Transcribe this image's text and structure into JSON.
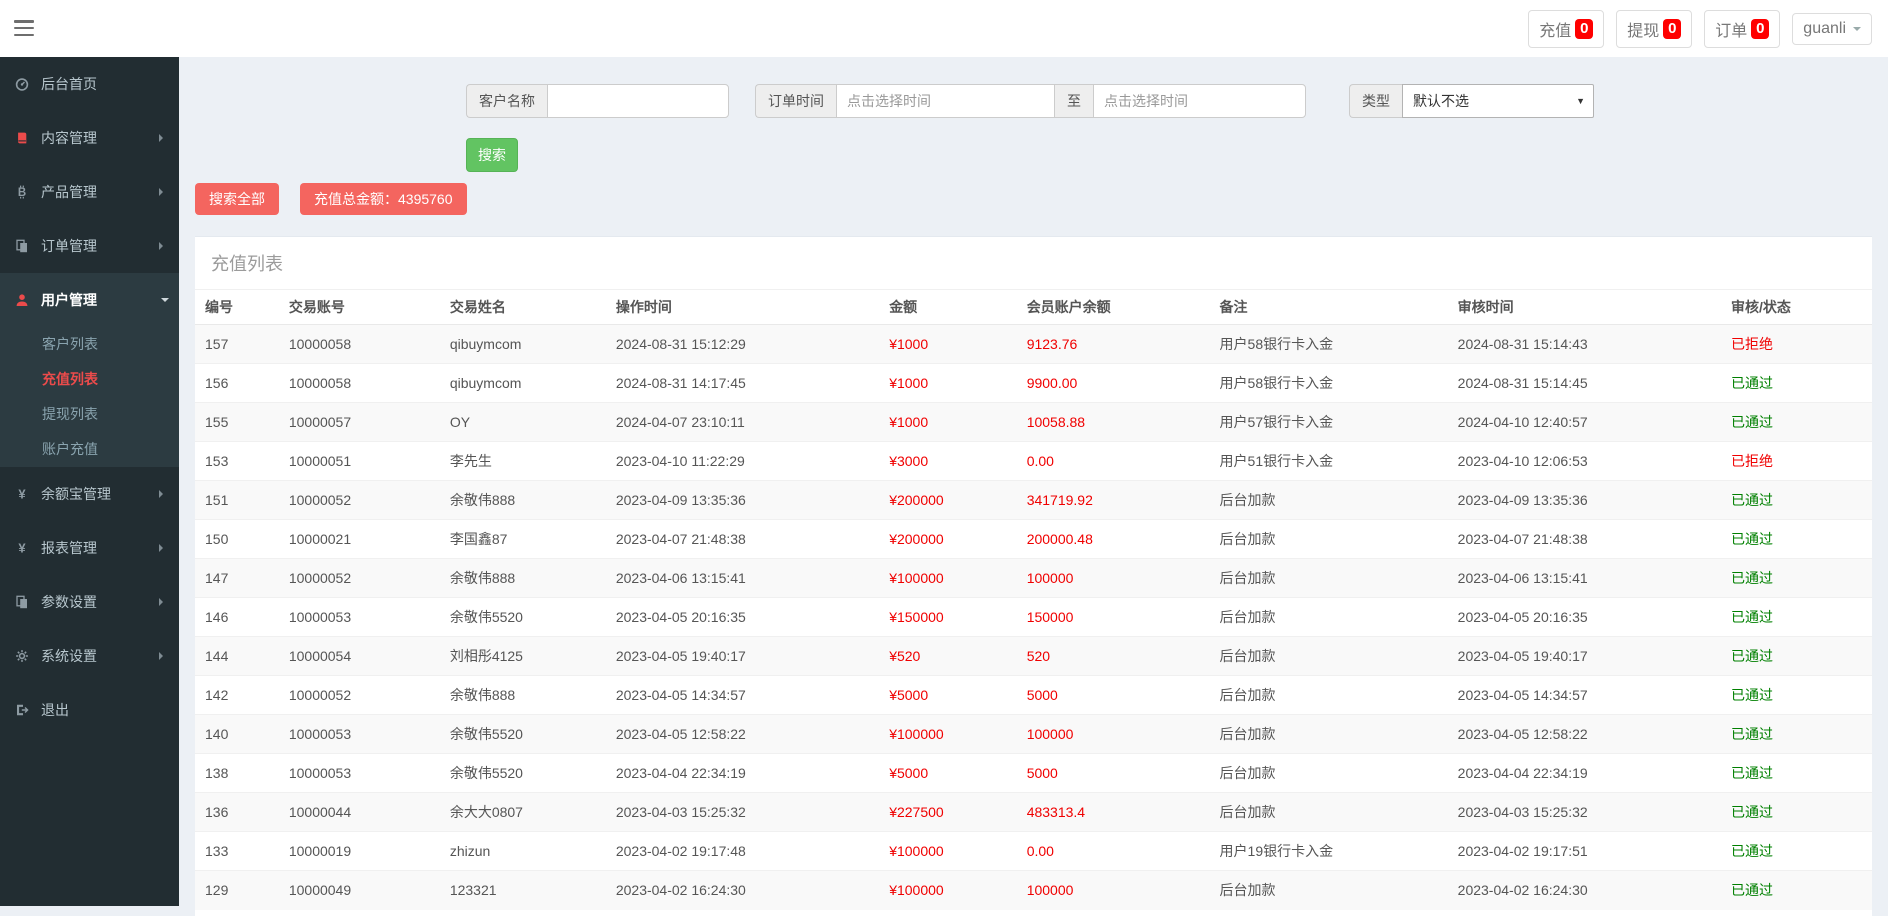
{
  "topbar": {
    "buttons": [
      {
        "label": "充值",
        "count": "0"
      },
      {
        "label": "提现",
        "count": "0"
      },
      {
        "label": "订单",
        "count": "0"
      }
    ],
    "user": {
      "name": "guanli"
    }
  },
  "sidebar": {
    "items": [
      {
        "key": "home",
        "label": "后台首页",
        "icon": "dashboard",
        "has_children": false,
        "icon_red": false
      },
      {
        "key": "content",
        "label": "内容管理",
        "icon": "book",
        "has_children": true,
        "icon_red": true
      },
      {
        "key": "product",
        "label": "产品管理",
        "icon": "bitcoin",
        "has_children": true,
        "icon_red": false
      },
      {
        "key": "order",
        "label": "订单管理",
        "icon": "files",
        "has_children": true,
        "icon_red": false
      },
      {
        "key": "user",
        "label": "用户管理",
        "icon": "user",
        "has_children": true,
        "icon_red": true,
        "active": true,
        "children": [
          {
            "key": "customer-list",
            "label": "客户列表",
            "active": false
          },
          {
            "key": "recharge-list",
            "label": "充值列表",
            "active": true
          },
          {
            "key": "withdraw-list",
            "label": "提现列表",
            "active": false
          },
          {
            "key": "account-recharge",
            "label": "账户充值",
            "active": false
          }
        ]
      },
      {
        "key": "yuebao",
        "label": "余额宝管理",
        "icon": "yen",
        "has_children": true,
        "icon_red": false
      },
      {
        "key": "report",
        "label": "报表管理",
        "icon": "yen",
        "has_children": true,
        "icon_red": false
      },
      {
        "key": "params",
        "label": "参数设置",
        "icon": "files",
        "has_children": true,
        "icon_red": false
      },
      {
        "key": "system",
        "label": "系统设置",
        "icon": "gears",
        "has_children": true,
        "icon_red": false
      },
      {
        "key": "logout",
        "label": "退出",
        "icon": "logout",
        "has_children": false,
        "icon_red": false
      }
    ]
  },
  "filters": {
    "customer_label": "客户名称",
    "customer_value": "",
    "time_label": "订单时间",
    "time_placeholder": "点击选择时间",
    "to_label": "至",
    "type_label": "类型",
    "type_value": "默认不选",
    "search_label": "搜索"
  },
  "summary": {
    "search_all": "搜索全部",
    "total": "充值总金额：4395760"
  },
  "panel": {
    "title": "充值列表"
  },
  "table": {
    "columns": [
      "编号",
      "交易账号",
      "交易姓名",
      "操作时间",
      "金额",
      "会员账户余额",
      "备注",
      "审核时间",
      "审核/状态"
    ],
    "rows": [
      {
        "id": "157",
        "account": "10000058",
        "name": "qibuymcom",
        "time": "2024-08-31 15:12:29",
        "amount": "¥1000",
        "balance": "9123.76",
        "note": "用户58银行卡入金",
        "audit_time": "2024-08-31 15:14:43",
        "status": "已拒绝",
        "state": "rejected"
      },
      {
        "id": "156",
        "account": "10000058",
        "name": "qibuymcom",
        "time": "2024-08-31 14:17:45",
        "amount": "¥1000",
        "balance": "9900.00",
        "note": "用户58银行卡入金",
        "audit_time": "2024-08-31 15:14:45",
        "status": "已通过",
        "state": "approved"
      },
      {
        "id": "155",
        "account": "10000057",
        "name": "OY",
        "time": "2024-04-07 23:10:11",
        "amount": "¥1000",
        "balance": "10058.88",
        "note": "用户57银行卡入金",
        "audit_time": "2024-04-10 12:40:57",
        "status": "已通过",
        "state": "approved"
      },
      {
        "id": "153",
        "account": "10000051",
        "name": "李先生",
        "time": "2023-04-10 11:22:29",
        "amount": "¥3000",
        "balance": "0.00",
        "note": "用户51银行卡入金",
        "audit_time": "2023-04-10 12:06:53",
        "status": "已拒绝",
        "state": "rejected"
      },
      {
        "id": "151",
        "account": "10000052",
        "name": "余敬伟888",
        "time": "2023-04-09 13:35:36",
        "amount": "¥200000",
        "balance": "341719.92",
        "note": "后台加款",
        "audit_time": "2023-04-09 13:35:36",
        "status": "已通过",
        "state": "approved"
      },
      {
        "id": "150",
        "account": "10000021",
        "name": "李国鑫87",
        "time": "2023-04-07 21:48:38",
        "amount": "¥200000",
        "balance": "200000.48",
        "note": "后台加款",
        "audit_time": "2023-04-07 21:48:38",
        "status": "已通过",
        "state": "approved"
      },
      {
        "id": "147",
        "account": "10000052",
        "name": "余敬伟888",
        "time": "2023-04-06 13:15:41",
        "amount": "¥100000",
        "balance": "100000",
        "note": "后台加款",
        "audit_time": "2023-04-06 13:15:41",
        "status": "已通过",
        "state": "approved"
      },
      {
        "id": "146",
        "account": "10000053",
        "name": "余敬伟5520",
        "time": "2023-04-05 20:16:35",
        "amount": "¥150000",
        "balance": "150000",
        "note": "后台加款",
        "audit_time": "2023-04-05 20:16:35",
        "status": "已通过",
        "state": "approved"
      },
      {
        "id": "144",
        "account": "10000054",
        "name": "刘相彤4125",
        "time": "2023-04-05 19:40:17",
        "amount": "¥520",
        "balance": "520",
        "note": "后台加款",
        "audit_time": "2023-04-05 19:40:17",
        "status": "已通过",
        "state": "approved"
      },
      {
        "id": "142",
        "account": "10000052",
        "name": "余敬伟888",
        "time": "2023-04-05 14:34:57",
        "amount": "¥5000",
        "balance": "5000",
        "note": "后台加款",
        "audit_time": "2023-04-05 14:34:57",
        "status": "已通过",
        "state": "approved"
      },
      {
        "id": "140",
        "account": "10000053",
        "name": "余敬伟5520",
        "time": "2023-04-05 12:58:22",
        "amount": "¥100000",
        "balance": "100000",
        "note": "后台加款",
        "audit_time": "2023-04-05 12:58:22",
        "status": "已通过",
        "state": "approved"
      },
      {
        "id": "138",
        "account": "10000053",
        "name": "余敬伟5520",
        "time": "2023-04-04 22:34:19",
        "amount": "¥5000",
        "balance": "5000",
        "note": "后台加款",
        "audit_time": "2023-04-04 22:34:19",
        "status": "已通过",
        "state": "approved"
      },
      {
        "id": "136",
        "account": "10000044",
        "name": "余大大0807",
        "time": "2023-04-03 15:25:32",
        "amount": "¥227500",
        "balance": "483313.4",
        "note": "后台加款",
        "audit_time": "2023-04-03 15:25:32",
        "status": "已通过",
        "state": "approved"
      },
      {
        "id": "133",
        "account": "10000019",
        "name": "zhizun",
        "time": "2023-04-02 19:17:48",
        "amount": "¥100000",
        "balance": "0.00",
        "note": "用户19银行卡入金",
        "audit_time": "2023-04-02 19:17:51",
        "status": "已通过",
        "state": "approved"
      },
      {
        "id": "129",
        "account": "10000049",
        "name": "123321",
        "time": "2023-04-02 16:24:30",
        "amount": "¥100000",
        "balance": "100000",
        "note": "后台加款",
        "audit_time": "2023-04-02 16:24:30",
        "status": "已通过",
        "state": "approved"
      }
    ]
  }
}
